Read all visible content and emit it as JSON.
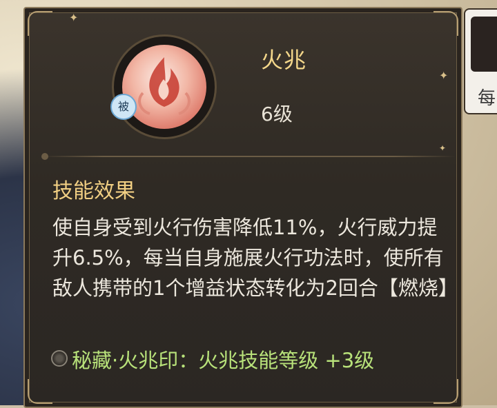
{
  "skill": {
    "name": "火兆",
    "level": "6级",
    "badge": "被",
    "icon": "flame-icon"
  },
  "effect": {
    "heading": "技能效果",
    "description": "使自身受到火行伤害降低11%，火行威力提升6.5%，每当自身施展火行功法时，使所有敌人携带的1个增益状态转化为2回合【燃烧】"
  },
  "bonus": {
    "text": "秘藏·火兆印：火兆技能等级 +3级",
    "icon": "swirl-icon"
  },
  "side_card": {
    "text": "每"
  },
  "colors": {
    "title": "#f4d78a",
    "heading": "#f1cf83",
    "bonus": "#b8e27a",
    "body": "#ece7dd"
  }
}
